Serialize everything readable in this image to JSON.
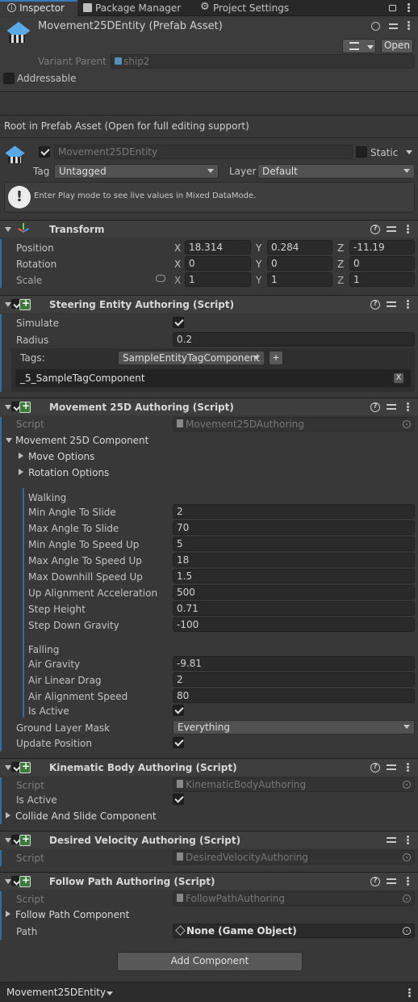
{
  "tabs": [
    {
      "label": "Inspector",
      "icon": "info-icon"
    },
    {
      "label": "Package Manager",
      "icon": "package-icon"
    },
    {
      "label": "Project Settings",
      "icon": "gear-icon"
    }
  ],
  "asset": {
    "title": "Movement25DEntity (Prefab Asset)",
    "open_label": "Open",
    "variant_parent_label": "Variant Parent",
    "variant_parent_value": "ship2",
    "addressable_label": "Addressable",
    "root_notice": "Root in Prefab Asset (Open for full editing support)"
  },
  "gameobject": {
    "name": "Movement25DEntity",
    "static_label": "Static",
    "tag_label": "Tag",
    "tag_value": "Untagged",
    "layer_label": "Layer",
    "layer_value": "Default",
    "info_message": "Enter Play mode to see live values in Mixed DataMode."
  },
  "transform": {
    "title": "Transform",
    "position_label": "Position",
    "rotation_label": "Rotation",
    "scale_label": "Scale",
    "axis_x": "X",
    "axis_y": "Y",
    "axis_z": "Z",
    "position": {
      "x": "18.314",
      "y": "0.284",
      "z": "-11.19"
    },
    "rotation": {
      "x": "0",
      "y": "0",
      "z": "0"
    },
    "scale": {
      "x": "1",
      "y": "1",
      "z": "1"
    }
  },
  "steering": {
    "title": "Steering Entity Authoring (Script)",
    "simulate_label": "Simulate",
    "radius_label": "Radius",
    "radius_value": "0.2",
    "tags_label": "Tags:",
    "tags_dropdown": "SampleEntityTagComponent",
    "add_label": "+",
    "tag_item": "_5_SampleTagComponent",
    "remove_label": "X"
  },
  "movement": {
    "title": "Movement 25D Authoring (Script)",
    "script_label": "Script",
    "script_value": "Movement25DAuthoring",
    "component_label": "Movement 25D Component",
    "move_options": "Move Options",
    "rotation_options": "Rotation Options",
    "walking_header": "Walking",
    "walking": [
      {
        "label": "Min Angle To Slide",
        "value": "2"
      },
      {
        "label": "Max Angle To Slide",
        "value": "70"
      },
      {
        "label": "Min Angle To Speed Up",
        "value": "5"
      },
      {
        "label": "Max Angle To Speed Up",
        "value": "18"
      },
      {
        "label": "Max Downhill Speed Up",
        "value": "1.5"
      },
      {
        "label": "Up Alignment Acceleration",
        "value": "500"
      },
      {
        "label": "Step Height",
        "value": "0.71"
      },
      {
        "label": "Step Down Gravity",
        "value": "-100"
      }
    ],
    "falling_header": "Falling",
    "falling": [
      {
        "label": "Air Gravity",
        "value": "-9.81"
      },
      {
        "label": "Air Linear Drag",
        "value": "2"
      },
      {
        "label": "Air Alignment Speed",
        "value": "80"
      }
    ],
    "is_active_label": "Is Active",
    "ground_layer_label": "Ground Layer Mask",
    "ground_layer_value": "Everything",
    "update_position_label": "Update Position"
  },
  "kinematic": {
    "title": "Kinematic Body Authoring (Script)",
    "script_label": "Script",
    "script_value": "KinematicBodyAuthoring",
    "is_active_label": "Is Active",
    "collide_label": "Collide And Slide Component"
  },
  "desired": {
    "title": "Desired Velocity Authoring (Script)",
    "script_label": "Script",
    "script_value": "DesiredVelocityAuthoring"
  },
  "follow": {
    "title": "Follow Path Authoring (Script)",
    "script_label": "Script",
    "script_value": "FollowPathAuthoring",
    "component_label": "Follow Path Component",
    "path_label": "Path",
    "path_value": "None (Game Object)"
  },
  "add_component_label": "Add Component",
  "footer_label": "Movement25DEntity"
}
